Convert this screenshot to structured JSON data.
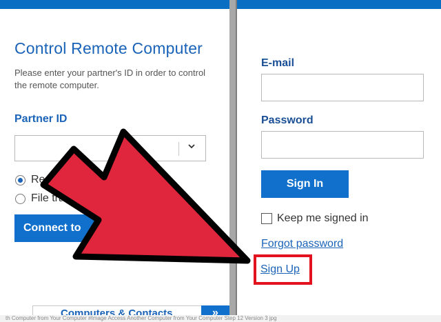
{
  "left_panel": {
    "title": "Control Remote Computer",
    "description": "Please enter your partner's ID in order to control the remote computer.",
    "partner_id_label": "Partner ID",
    "partner_id_value": "",
    "radio_options": [
      {
        "label": "Re",
        "checked": true
      },
      {
        "label": "File tra",
        "checked": false
      }
    ],
    "connect_button_label": "Connect to"
  },
  "right_panel": {
    "email_label": "E-mail",
    "email_value": "",
    "password_label": "Password",
    "password_value": "",
    "signin_button_label": "Sign In",
    "keep_signed_in_label": "Keep me signed in",
    "keep_signed_in_checked": false,
    "forgot_password_label": "Forgot password",
    "signup_label": "Sign Up"
  },
  "bottom_bar": {
    "partial_text": "Computers & Contacts",
    "button_glyph": "»"
  },
  "caption_text": "th Computer from Your Computer  #Image Access Another Computer from Your Computer Step 12 Version 3 jpg",
  "annotation": {
    "arrow_color": "#e0263c",
    "highlight_color": "#e3121f"
  },
  "colors": {
    "accent": "#1170cc",
    "title_blue": "#1a63b8"
  }
}
